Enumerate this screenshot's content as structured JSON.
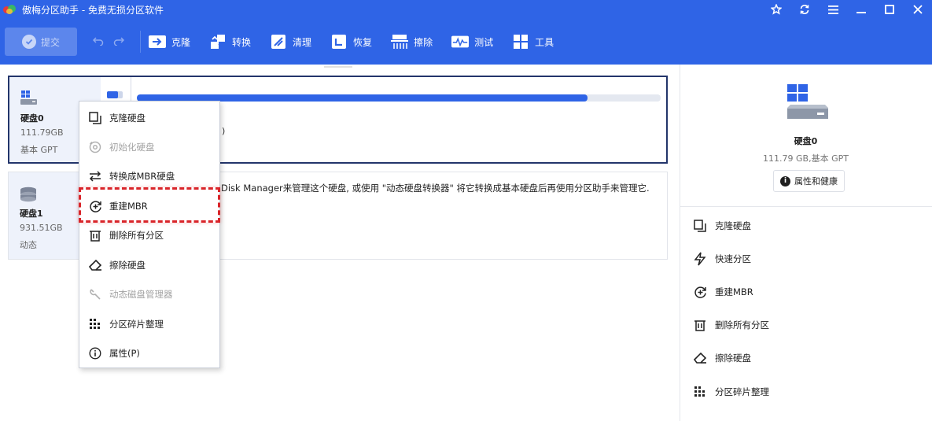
{
  "app": {
    "title": "傲梅分区助手 - 免费无损分区软件"
  },
  "window_controls": [
    "star-icon",
    "refresh-icon",
    "menu-icon",
    "minimize-icon",
    "maximize-icon",
    "close-icon"
  ],
  "toolbar": {
    "submit_label": "提交",
    "items": [
      {
        "label": "克隆",
        "icon": "clone-icon"
      },
      {
        "label": "转换",
        "icon": "convert-icon"
      },
      {
        "label": "清理",
        "icon": "clean-icon"
      },
      {
        "label": "恢复",
        "icon": "restore-icon"
      },
      {
        "label": "擦除",
        "icon": "wipe-icon"
      },
      {
        "label": "测试",
        "icon": "test-icon"
      },
      {
        "label": "工具",
        "icon": "tools-icon"
      }
    ]
  },
  "disks": [
    {
      "name": "硬盘0",
      "size": "111.79GB",
      "type": "基本 GPT",
      "usage_fraction": 0.86,
      "partial_text": ")"
    },
    {
      "name": "硬盘1",
      "size": "931.51GB",
      "type": "动态",
      "message": "Disk Manager来管理这个硬盘, 或使用 \"动态硬盘转换器\" 将它转换成基本硬盘后再使用分区助手来管理它."
    }
  ],
  "context_menu": {
    "items": [
      {
        "label": "克隆硬盘",
        "icon": "clone-disk-icon",
        "disabled": false
      },
      {
        "label": "初始化硬盘",
        "icon": "initialize-icon",
        "disabled": true
      },
      {
        "label": "转换成MBR硬盘",
        "icon": "convert-mbr-icon",
        "disabled": false
      },
      {
        "label": "重建MBR",
        "icon": "rebuild-mbr-icon",
        "disabled": false,
        "highlighted": true
      },
      {
        "label": "删除所有分区",
        "icon": "trash-icon",
        "disabled": false
      },
      {
        "label": "擦除硬盘",
        "icon": "eraser-icon",
        "disabled": false
      },
      {
        "label": "动态磁盘管理器",
        "icon": "wrench-icon",
        "disabled": true
      },
      {
        "label": "分区碎片整理",
        "icon": "defrag-icon",
        "disabled": false
      },
      {
        "label": "属性(P)",
        "icon": "info-icon",
        "disabled": false
      }
    ]
  },
  "right_panel": {
    "disk_name": "硬盘0",
    "disk_size": "111.79 GB,基本 GPT",
    "properties_label": "属性和健康",
    "actions": [
      {
        "label": "克隆硬盘",
        "icon": "clone-disk-icon"
      },
      {
        "label": "快速分区",
        "icon": "lightning-icon"
      },
      {
        "label": "重建MBR",
        "icon": "rebuild-mbr-icon"
      },
      {
        "label": "删除所有分区",
        "icon": "trash-icon"
      },
      {
        "label": "擦除硬盘",
        "icon": "eraser-icon"
      },
      {
        "label": "分区碎片整理",
        "icon": "defrag-icon"
      }
    ]
  },
  "colors": {
    "brand_blue": "#2f64e6",
    "highlight_red": "#d9252a",
    "disabled_gray": "#a3a3a3"
  }
}
